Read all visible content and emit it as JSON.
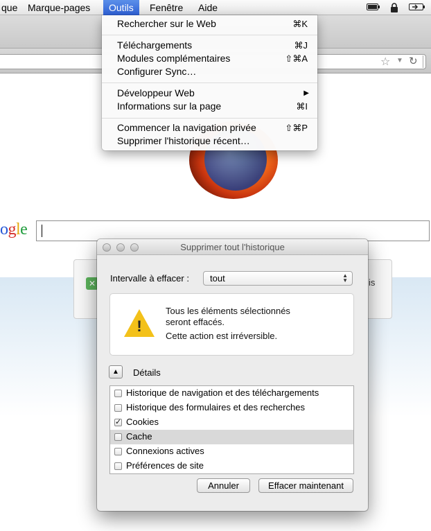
{
  "menubar": {
    "items": [
      "que",
      "Marque-pages",
      "Outils",
      "Fenêtre",
      "Aide"
    ],
    "status_icons": [
      "battery-icon",
      "lock-icon",
      "battery-charging-icon"
    ]
  },
  "tools_menu": {
    "items": [
      {
        "label": "Rechercher sur le Web",
        "shortcut": "⌘K"
      },
      {
        "label": "Téléchargements",
        "shortcut": "⌘J"
      },
      {
        "label": "Modules complémentaires",
        "shortcut": "⇧⌘A"
      },
      {
        "label": "Configurer Sync…",
        "shortcut": ""
      },
      {
        "label": "Développeur Web",
        "shortcut": "▶"
      },
      {
        "label": "Informations sur la page",
        "shortcut": "⌘I"
      },
      {
        "label": "Commencer la navigation privée",
        "shortcut": "⇧⌘P"
      },
      {
        "label": "Supprimer l'historique récent…",
        "shortcut": ""
      }
    ]
  },
  "page": {
    "google_logo": "ogle",
    "snippet_tail": "is"
  },
  "dialog": {
    "title": "Supprimer tout l'historique",
    "range_label": "Intervalle à effacer :",
    "range_value": "tout",
    "warning_line1": "Tous les éléments sélectionnés",
    "warning_line2": "seront effacés.",
    "warning_line3": "Cette action est irréversible.",
    "details_label": "Détails",
    "items": [
      {
        "label": "Historique de navigation et des téléchargements",
        "checked": false
      },
      {
        "label": "Historique des formulaires et des recherches",
        "checked": false
      },
      {
        "label": "Cookies",
        "checked": true
      },
      {
        "label": "Cache",
        "checked": false
      },
      {
        "label": "Connexions actives",
        "checked": false
      },
      {
        "label": "Préférences de site",
        "checked": false
      }
    ],
    "cancel_label": "Annuler",
    "confirm_label": "Effacer maintenant"
  },
  "colors": {
    "menu_highlight": "#3a6fe0",
    "warning_yellow": "#f3c11a"
  }
}
